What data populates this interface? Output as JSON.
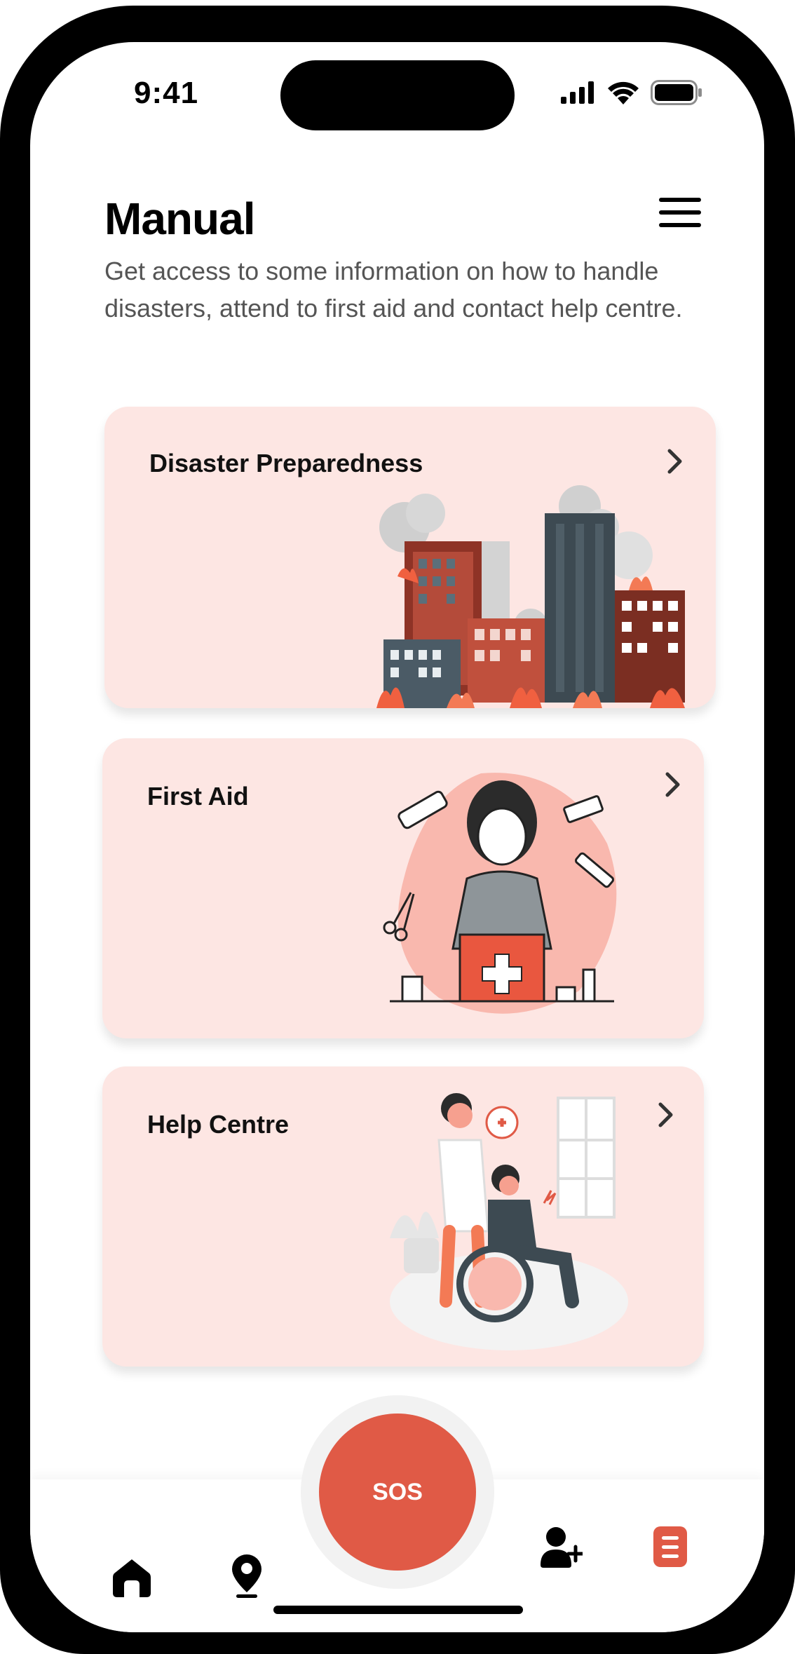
{
  "status_bar": {
    "time": "9:41"
  },
  "header": {
    "title": "Manual",
    "subtitle": "Get access to some information on how to handle disasters, attend to first aid and contact help centre."
  },
  "cards": [
    {
      "title": "Disaster Preparedness"
    },
    {
      "title": "First Aid"
    },
    {
      "title": "Help Centre"
    }
  ],
  "sos": {
    "label": "SOS"
  },
  "nav": {
    "items": [
      "home-icon",
      "location-pin-icon",
      "add-user-icon",
      "manual-icon"
    ],
    "active_color": "#e05a46"
  },
  "colors": {
    "accent": "#e05a46",
    "card_bg": "#fde6e3",
    "text": "#000000"
  }
}
